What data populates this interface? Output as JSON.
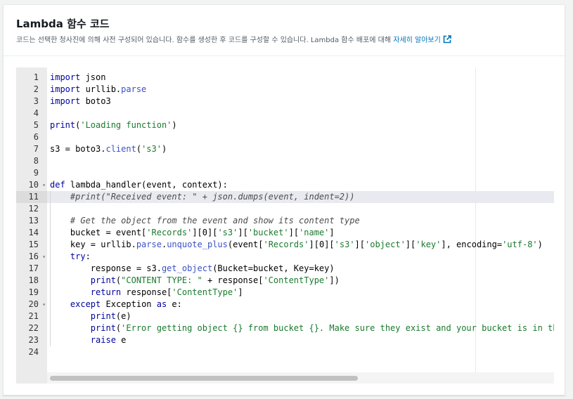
{
  "panel": {
    "title": "Lambda 함수 코드",
    "description": "코드는 선택한 청사진에 의해 사전 구성되어 있습니다. 함수를 생성한 후 코드를 구성할 수 있습니다. Lambda 함수 배포에 대해 ",
    "learn_more": "자세히 알아보기"
  },
  "editor": {
    "active_line": 11,
    "fold_lines": [
      10,
      16,
      20
    ],
    "lines": [
      {
        "n": "1",
        "text": "import json"
      },
      {
        "n": "2",
        "text": "import urllib.parse"
      },
      {
        "n": "3",
        "text": "import boto3"
      },
      {
        "n": "4",
        "text": ""
      },
      {
        "n": "5",
        "text": "print('Loading function')"
      },
      {
        "n": "6",
        "text": ""
      },
      {
        "n": "7",
        "text": "s3 = boto3.client('s3')"
      },
      {
        "n": "8",
        "text": ""
      },
      {
        "n": "9",
        "text": ""
      },
      {
        "n": "10",
        "text": "def lambda_handler(event, context):"
      },
      {
        "n": "11",
        "text": "    #print(\"Received event: \" + json.dumps(event, indent=2))"
      },
      {
        "n": "12",
        "text": ""
      },
      {
        "n": "13",
        "text": "    # Get the object from the event and show its content type"
      },
      {
        "n": "14",
        "text": "    bucket = event['Records'][0]['s3']['bucket']['name']"
      },
      {
        "n": "15",
        "text": "    key = urllib.parse.unquote_plus(event['Records'][0]['s3']['object']['key'], encoding='utf-8')"
      },
      {
        "n": "16",
        "text": "    try:"
      },
      {
        "n": "17",
        "text": "        response = s3.get_object(Bucket=bucket, Key=key)"
      },
      {
        "n": "18",
        "text": "        print(\"CONTENT TYPE: \" + response['ContentType'])"
      },
      {
        "n": "19",
        "text": "        return response['ContentType']"
      },
      {
        "n": "20",
        "text": "    except Exception as e:"
      },
      {
        "n": "21",
        "text": "        print(e)"
      },
      {
        "n": "22",
        "text": "        print('Error getting object {} from bucket {}. Make sure they exist and your bucket is in the same region as this function.'.format(key, bucket))"
      },
      {
        "n": "23",
        "text": "        raise e"
      },
      {
        "n": "24",
        "text": ""
      }
    ]
  },
  "colors": {
    "keyword": "#0000a2",
    "function": "#3b52c4",
    "string": "#1a7a2e",
    "comment": "#4c4c4c",
    "link": "#0073bb"
  }
}
